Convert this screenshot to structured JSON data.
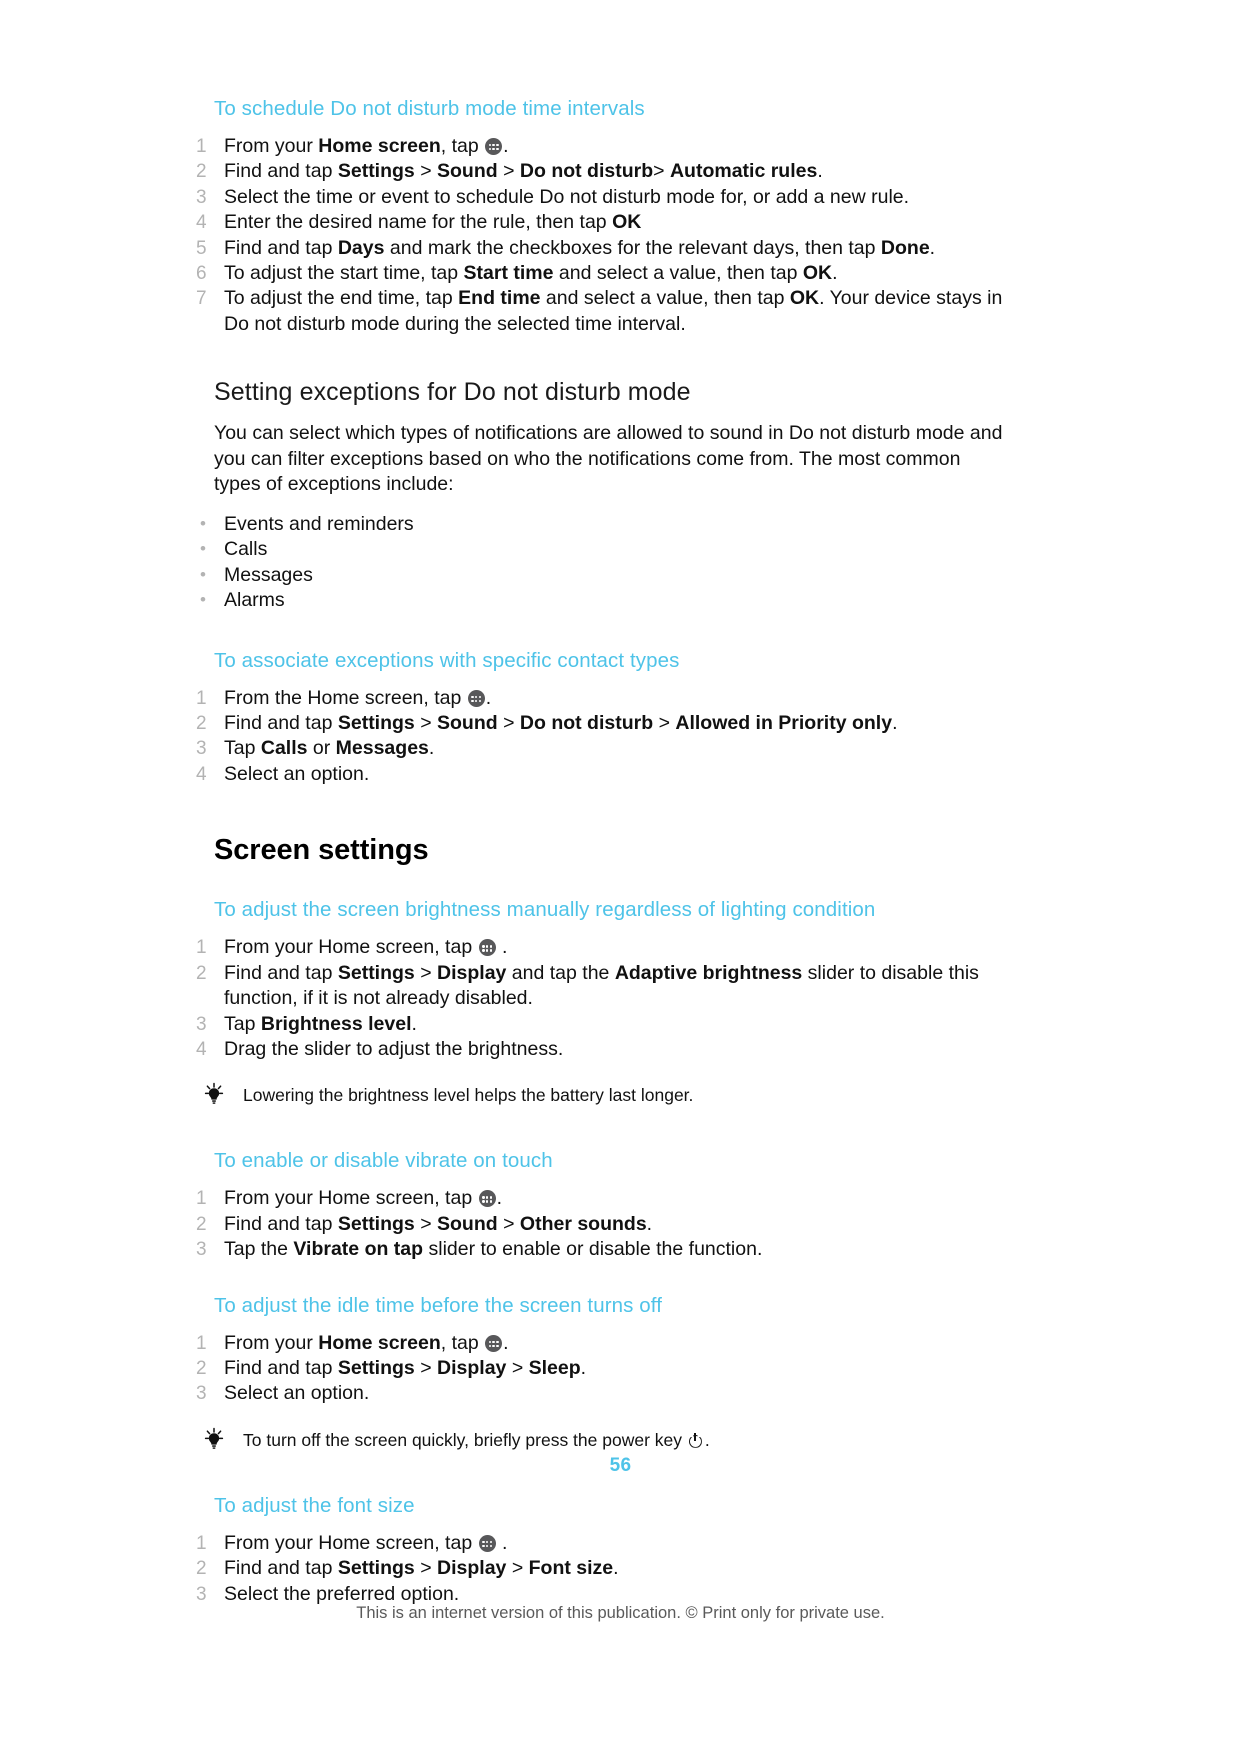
{
  "page": {
    "number": "56",
    "footer_note": "This is an internet version of this publication. © Print only for private use.",
    "accent_color": "#4ec3e8",
    "number_color": "#b3b3b3"
  },
  "sections": {
    "schedule_dnd": {
      "heading": "To schedule Do not disturb mode time intervals",
      "steps": [
        {
          "num": "1",
          "parts": [
            "From your ",
            "Home screen",
            ", tap ",
            "[appicon]",
            "."
          ]
        },
        {
          "num": "2",
          "parts": [
            "Find and tap ",
            "Settings",
            " > ",
            "Sound",
            " > ",
            "Do not disturb",
            "> ",
            "Automatic rules",
            "."
          ]
        },
        {
          "num": "3",
          "parts": [
            "Select the time or event to schedule Do not disturb mode for, or add a new rule."
          ]
        },
        {
          "num": "4",
          "parts": [
            "Enter the desired name for the rule, then tap ",
            "OK"
          ]
        },
        {
          "num": "5",
          "parts": [
            "Find and tap ",
            "Days",
            " and mark the checkboxes for the relevant days, then tap ",
            "Done",
            "."
          ]
        },
        {
          "num": "6",
          "parts": [
            "To adjust the start time, tap ",
            "Start time",
            " and select a value, then tap ",
            "OK",
            "."
          ]
        },
        {
          "num": "7",
          "parts": [
            "To adjust the end time, tap ",
            "End time",
            " and select a value, then tap ",
            "OK",
            ". Your device stays in Do not disturb mode during the selected time interval."
          ]
        }
      ]
    },
    "exceptions": {
      "heading": "Setting exceptions for Do not disturb mode",
      "paragraph": "You can select which types of notifications are allowed to sound in Do not disturb mode and you can filter exceptions based on who the notifications come from. The most common types of exceptions include:",
      "bullets": [
        "Events and reminders",
        "Calls",
        "Messages",
        "Alarms"
      ]
    },
    "associate_exceptions": {
      "heading": "To associate exceptions with specific contact types",
      "steps": [
        {
          "num": "1",
          "parts": [
            "From the Home screen, tap ",
            "[appicon]",
            "."
          ]
        },
        {
          "num": "2",
          "parts": [
            "Find and tap ",
            "Settings",
            " > ",
            "Sound",
            " > ",
            "Do not disturb",
            " > ",
            "Allowed in Priority only",
            "."
          ]
        },
        {
          "num": "3",
          "parts": [
            "Tap ",
            "Calls",
            " or ",
            "Messages",
            "."
          ]
        },
        {
          "num": "4",
          "parts": [
            "Select an option."
          ]
        }
      ]
    },
    "screen_settings": {
      "heading": "Screen settings"
    },
    "brightness": {
      "heading": "To adjust the screen brightness manually regardless of lighting condition",
      "steps": [
        {
          "num": "1",
          "parts": [
            "From your Home screen, tap ",
            "[appicon]",
            " ."
          ]
        },
        {
          "num": "2",
          "parts": [
            "Find and tap ",
            "Settings",
            " > ",
            "Display",
            " and tap the ",
            "Adaptive brightness",
            " slider to disable this function, if it is not already disabled."
          ]
        },
        {
          "num": "3",
          "parts": [
            "Tap ",
            "Brightness level",
            "."
          ]
        },
        {
          "num": "4",
          "parts": [
            "Drag the slider to adjust the brightness."
          ]
        }
      ],
      "tip": "Lowering the brightness level helps the battery last longer."
    },
    "vibrate": {
      "heading": "To enable or disable vibrate on touch",
      "steps": [
        {
          "num": "1",
          "parts": [
            "From your Home screen, tap ",
            "[appicon]",
            "."
          ]
        },
        {
          "num": "2",
          "parts": [
            "Find and tap ",
            "Settings",
            " > ",
            "Sound",
            " > ",
            "Other sounds",
            "."
          ]
        },
        {
          "num": "3",
          "parts": [
            "Tap the ",
            "Vibrate on tap",
            " slider to enable or disable the function."
          ]
        }
      ]
    },
    "idle_time": {
      "heading": "To adjust the idle time before the screen turns off",
      "steps": [
        {
          "num": "1",
          "parts": [
            "From your ",
            "Home screen",
            ", tap ",
            "[appicon]",
            "."
          ]
        },
        {
          "num": "2",
          "parts": [
            "Find and tap ",
            "Settings",
            " > ",
            "Display",
            " > ",
            "Sleep",
            "."
          ]
        },
        {
          "num": "3",
          "parts": [
            "Select an option."
          ]
        }
      ],
      "tip_before": "To turn off the screen quickly, briefly press the power key ",
      "tip_after": "."
    },
    "font_size": {
      "heading": "To adjust the font size",
      "steps": [
        {
          "num": "1",
          "parts": [
            "From your Home screen, tap ",
            "[appicon]",
            " ."
          ]
        },
        {
          "num": "2",
          "parts": [
            "Find and tap ",
            "Settings",
            " > ",
            "Display",
            " > ",
            "Font size",
            "."
          ]
        },
        {
          "num": "3",
          "parts": [
            "Select the preferred option."
          ]
        }
      ]
    }
  }
}
